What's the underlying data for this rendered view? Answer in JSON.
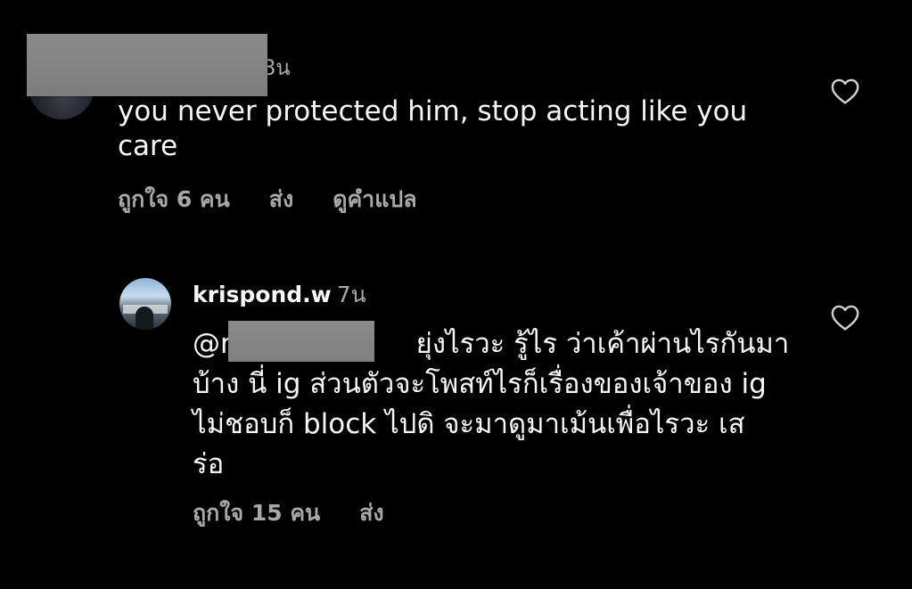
{
  "comments": [
    {
      "username": "",
      "time": "8น",
      "text": "you never protected him, stop acting like you care",
      "likes_label": "ถูกใจ 6 คน",
      "reply_label": "ส่ง",
      "translate_label": "ดูคำแปล",
      "like_icon": "heart-outline-icon"
    },
    {
      "username": "krispond.w",
      "time": "7น",
      "text": "@r ยุ่งไรวะ รู้ไร ว่าเค้าผ่านไรกันมาบ้าง นี่ ig ส่วนตัวจะโพสท์ไรก็เรื่องของเจ้าของ ig ไม่ชอบก็ block ไปดิ จะมาดูมาเม้นเพื่อไรวะ เสร่อ",
      "text_lines": [
        "@r                     ยุ่งไรวะ รู้ไร ว่าเค้าผ่านไรกันมา",
        "บ้าง นี่ ig ส่วนตัวจะโพสท์ไรก็เรื่องของเจ้าของ ig",
        "ไม่ชอบก็ block ไปดิ จะมาดูมาเม้นเพื่อไรวะ เส",
        "ร่อ"
      ],
      "likes_label": "ถูกใจ 15 คน",
      "reply_label": "ส่ง",
      "like_icon": "heart-outline-icon"
    }
  ],
  "colors": {
    "background": "#000000",
    "primary_text": "#f5f5f5",
    "secondary_text": "#a8a8a8",
    "redaction": "#848484"
  }
}
